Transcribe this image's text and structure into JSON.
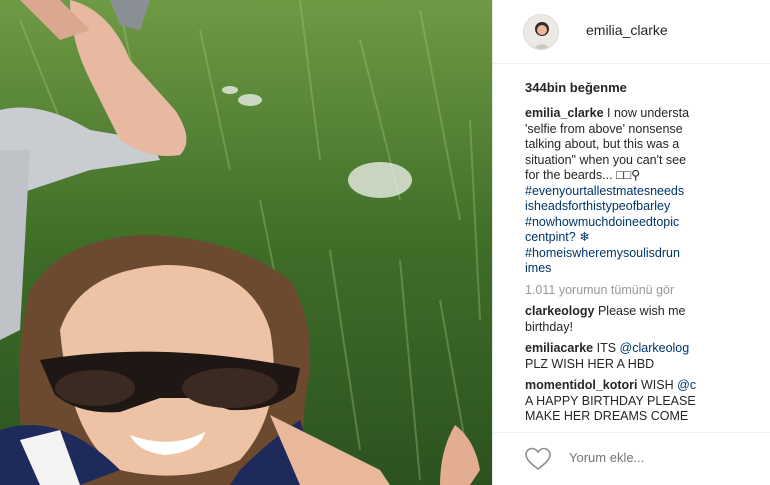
{
  "post": {
    "username": "emilia_clarke",
    "likes": "344bin beğenme",
    "caption": {
      "username": "emilia_clarke",
      "lines": [
        "I now understa",
        "'selfie from above' nonsense",
        "talking about, but this was a",
        "situation\" when you can't see",
        "for the beards... □□⚲"
      ],
      "hashtags": [
        "#evenyourtallestmatesneeds",
        "isheadsforthistypeofbarley",
        "#nowhowmuchdoineedtopic",
        "centpint? ❄",
        "#homeiswheremysoulisdrun",
        "imes"
      ]
    },
    "view_all_comments": "1.011 yorumun tümünü gör",
    "comments": [
      {
        "username": "clarkeology",
        "text": "Please wish me",
        "text2": "birthday!"
      },
      {
        "username": "emiliacarke",
        "text": "ITS",
        "mention": "@clarkeolog",
        "text2": "PLZ WISH HER A HBD"
      },
      {
        "username": "momentidol_kotori",
        "text": "WISH",
        "mention": "@c",
        "text2": "A HAPPY BIRTHDAY PLEASE",
        "text3": "MAKE HER DREAMS COME",
        "text4": "❤"
      }
    ],
    "add_comment_placeholder": "Yorum ekle..."
  },
  "icons": {
    "like": "heart-icon",
    "avatar": "profile-avatar"
  },
  "colors": {
    "link": "#003569",
    "muted": "#999999",
    "text": "#262626"
  }
}
